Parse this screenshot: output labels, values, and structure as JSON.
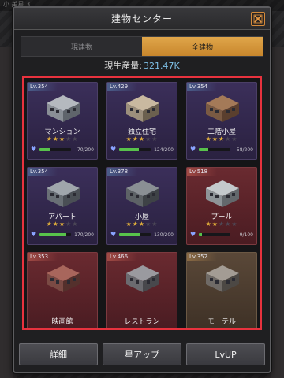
{
  "background": {
    "top_label": "小 美星 3"
  },
  "dialog": {
    "title": "建物センター",
    "close_icon": "close-x-icon"
  },
  "tabs": [
    {
      "label": "現建物",
      "active": false
    },
    {
      "label": "全建物",
      "active": true
    }
  ],
  "production": {
    "label": "現生産量:",
    "value": "321.47K"
  },
  "buildings": [
    {
      "level": "Lv.354",
      "name": "マンション",
      "stars": 3,
      "max_stars": 5,
      "progress": "70/200",
      "fill": 0.35,
      "rarity": "purple",
      "image": "mansion-building"
    },
    {
      "level": "Lv.429",
      "name": "独立住宅",
      "stars": 3,
      "max_stars": 5,
      "progress": "124/200",
      "fill": 0.62,
      "rarity": "purple",
      "image": "house-building"
    },
    {
      "level": "Lv.354",
      "name": "二階小屋",
      "stars": 3,
      "max_stars": 5,
      "progress": "58/200",
      "fill": 0.29,
      "rarity": "purple",
      "image": "two-story-shack"
    },
    {
      "level": "Lv.354",
      "name": "アパート",
      "stars": 3,
      "max_stars": 5,
      "progress": "170/200",
      "fill": 0.85,
      "rarity": "purple",
      "image": "apartment-building"
    },
    {
      "level": "Lv.378",
      "name": "小屋",
      "stars": 3,
      "max_stars": 5,
      "progress": "130/200",
      "fill": 0.65,
      "rarity": "purple",
      "image": "hut-building"
    },
    {
      "level": "Lv.518",
      "name": "プール",
      "stars": 2,
      "max_stars": 5,
      "progress": "9/100",
      "fill": 0.09,
      "rarity": "red",
      "image": "pool-building"
    },
    {
      "level": "Lv.353",
      "name": "映画館",
      "stars": 0,
      "max_stars": 0,
      "progress": "",
      "fill": 0,
      "rarity": "red",
      "image": "cinema-building"
    },
    {
      "level": "Lv.466",
      "name": "レストラン",
      "stars": 0,
      "max_stars": 0,
      "progress": "",
      "fill": 0,
      "rarity": "red",
      "image": "restaurant-building"
    },
    {
      "level": "Lv.352",
      "name": "モーテル",
      "stars": 0,
      "max_stars": 0,
      "progress": "",
      "fill": 0,
      "rarity": "gold",
      "image": "motel-building"
    }
  ],
  "actions": {
    "details": "詳細",
    "star_up": "星アップ",
    "level_up": "LvUP"
  },
  "colors": {
    "accent": "#d9993a",
    "highlight_border": "#e8323e",
    "production_value": "#7fc1e8",
    "progress_fill": "#58c24b"
  }
}
